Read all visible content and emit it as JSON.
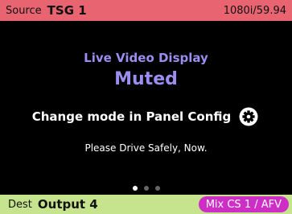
{
  "header": {
    "source_label": "Source",
    "source_value": "TSG 1",
    "format": "1080i/59.94",
    "background_color": "#e86470"
  },
  "main": {
    "title": "Live Video Display",
    "status": "Muted",
    "mode_message": "Change mode in Panel Config",
    "settings_icon": "gear-icon",
    "safety_message": "Please Drive Safely, Now.",
    "accent_color": "#9b8ef0",
    "pagination": {
      "total": 3,
      "active": 1
    }
  },
  "footer": {
    "dest_label": "Dest",
    "dest_value": "Output 4",
    "mix_label": "Mix CS 1 / AFV",
    "background_color": "#c6e38e",
    "badge_color": "#cc2ec6"
  }
}
